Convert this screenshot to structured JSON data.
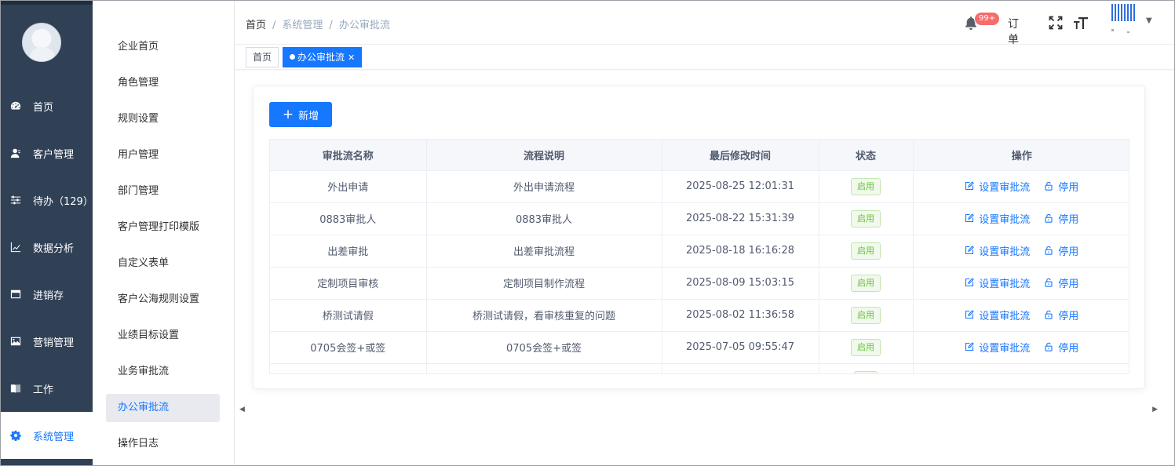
{
  "sidebar": {
    "items": [
      {
        "label": "首页",
        "icon": "dashboard-icon"
      },
      {
        "label": "客户管理",
        "icon": "user-icon"
      },
      {
        "label": "待办（129）",
        "icon": "sliders-icon"
      },
      {
        "label": "数据分析",
        "icon": "chart-icon"
      },
      {
        "label": "进销存",
        "icon": "window-icon"
      },
      {
        "label": "营销管理",
        "icon": "picture-icon"
      },
      {
        "label": "工作",
        "icon": "book-icon"
      },
      {
        "label": "系统管理",
        "icon": "gear-icon"
      }
    ],
    "active": "系统管理"
  },
  "subnav": {
    "items": [
      "企业首页",
      "角色管理",
      "规则设置",
      "用户管理",
      "部门管理",
      "客户管理打印模版",
      "自定义表单",
      "客户公海规则设置",
      "业绩目标设置",
      "业务审批流",
      "办公审批流",
      "操作日志"
    ],
    "active": "办公审批流"
  },
  "header": {
    "breadcrumb": [
      "首页",
      "系统管理",
      "办公审批流"
    ],
    "notification_badge": "99+",
    "order_label": "订单"
  },
  "tags": {
    "home": "首页",
    "current": "办公审批流"
  },
  "toolbar": {
    "add_label": "新增"
  },
  "table": {
    "columns": [
      "审批流名称",
      "流程说明",
      "最后修改时间",
      "状态",
      "操作"
    ],
    "rows": [
      {
        "name": "外出申请",
        "desc": "外出申请流程",
        "time": "2025-08-25 12:01:31",
        "status": "启用"
      },
      {
        "name": "0883审批人",
        "desc": "0883审批人",
        "time": "2025-08-22 15:31:39",
        "status": "启用"
      },
      {
        "name": "出差审批",
        "desc": "出差审批流程",
        "time": "2025-08-18 16:16:28",
        "status": "启用"
      },
      {
        "name": "定制项目审核",
        "desc": "定制项目制作流程",
        "time": "2025-08-09 15:03:15",
        "status": "启用"
      },
      {
        "name": "桥测试请假",
        "desc": "桥测试请假，看审核重复的问题",
        "time": "2025-08-02 11:36:58",
        "status": "启用"
      },
      {
        "name": "0705会签+或签",
        "desc": "0705会签+或签",
        "time": "2025-07-05 09:55:47",
        "status": "启用"
      }
    ],
    "op_labels": {
      "configure": "设置审批流",
      "disable": "停用"
    }
  },
  "colors": {
    "primary": "#1677ff",
    "sidebar_bg": "#304156",
    "success": "#67c23a"
  }
}
